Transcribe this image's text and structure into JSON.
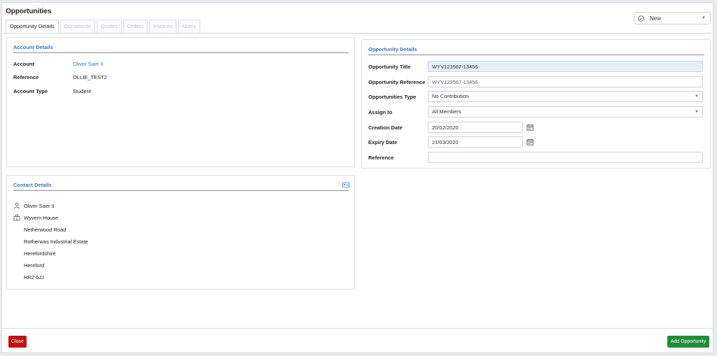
{
  "page": {
    "title": "Opportunities",
    "tabs": [
      {
        "label": "Opportunity Details",
        "active": true
      },
      {
        "label": "Documents",
        "active": false
      },
      {
        "label": "Quotes",
        "active": false
      },
      {
        "label": "Orders",
        "active": false
      },
      {
        "label": "Invoices",
        "active": false
      },
      {
        "label": "Notes",
        "active": false
      }
    ],
    "status": {
      "value": "New",
      "icon": "check-circle-icon"
    }
  },
  "account_details": {
    "title": "Account Details",
    "rows": [
      {
        "label": "Account",
        "value": "Oliver Saer II",
        "is_link": true
      },
      {
        "label": "Reference",
        "value": "OLLIE_TEST2",
        "is_link": false
      },
      {
        "label": "Account Type",
        "value": "Student",
        "is_link": false
      }
    ]
  },
  "contact_details": {
    "title": "Contact Details",
    "name": "Oliver Saer II",
    "company": "Wyvern House",
    "address_lines": [
      "Netherwood Road",
      "Rotherwas Industrial Estate",
      "Herefordshire",
      "Hereford",
      "HR2 6JJ"
    ]
  },
  "opportunity_details": {
    "title": "Opportunity Details",
    "fields": {
      "opportunity_title": {
        "label": "Opportunity Title",
        "value": "WYV123567-13456"
      },
      "opportunity_reference": {
        "label": "Opportunity Reference",
        "value": "WYV123567-13456"
      },
      "opportunities_type": {
        "label": "Opportunities Type",
        "value": "No Contribution"
      },
      "assign_to": {
        "label": "Assign to",
        "value": "All Members"
      },
      "creation_date": {
        "label": "Creation Date",
        "value": "20/02/2020"
      },
      "expiry_date": {
        "label": "Expiry Date",
        "value": "21/03/2020"
      },
      "reference": {
        "label": "Reference",
        "value": ""
      }
    }
  },
  "footer": {
    "close_label": "Close",
    "add_label": "Add Opportunity"
  },
  "colors": {
    "link": "#3a78c2",
    "close_button": "#c41212",
    "add_button": "#238b3a",
    "highlight_field": "#e7eef8"
  }
}
